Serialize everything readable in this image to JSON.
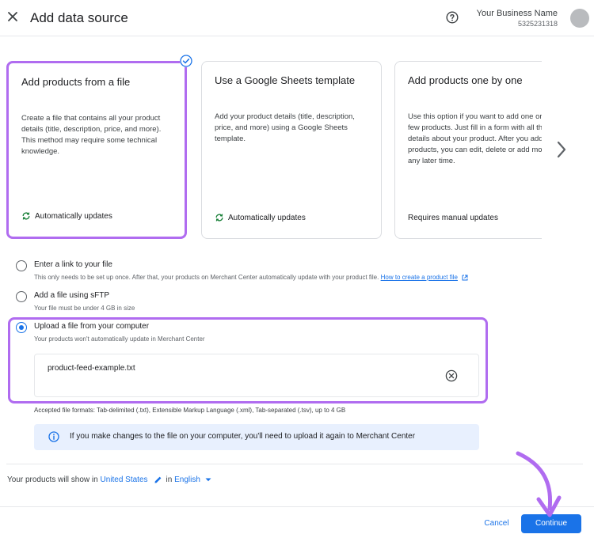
{
  "header": {
    "title": "Add data source",
    "business_name": "Your Business Name",
    "business_id": "5325231318"
  },
  "cards": [
    {
      "title": "Add products from a file",
      "description": "Create a file that contains all your product details (title, description, price, and more). This method may require some technical knowledge.",
      "footer": "Automatically updates",
      "footer_icon": "sync-icon",
      "selected": true
    },
    {
      "title": "Use a Google Sheets template",
      "description": "Add your product details (title, description, price, and more) using a Google Sheets template.",
      "footer": "Automatically updates",
      "footer_icon": "sync-icon",
      "selected": false
    },
    {
      "title": "Add products one by one",
      "description": "Use this option if you want to add one or just a few products. Just fill in a form with all the details about your product. After you add your products, you can edit, delete or add more at any later time.",
      "footer": "Requires manual updates",
      "selected": false
    }
  ],
  "options": [
    {
      "label": "Enter a link to your file",
      "sub": "This only needs to be set up once. After that, your products on Merchant Center automatically update with your product file.",
      "link": "How to create a product file"
    },
    {
      "label": "Add a file using sFTP",
      "sub": "Your file must be under 4 GB in size"
    },
    {
      "label": "Upload a file from your computer",
      "sub": "Your products won't automatically update in Merchant Center",
      "selected": true
    }
  ],
  "upload": {
    "file_name": "product-feed-example.txt",
    "formats": "Accepted file formats: Tab-delimited (.txt), Extensible Markup Language (.xml), Tab-separated (.tsv), up to 4 GB"
  },
  "info_banner": {
    "text": "If you make changes to the file on your computer, you'll need to upload it again to Merchant Center"
  },
  "country": {
    "prefix": "Your products will show in",
    "country": "United States",
    "in": "in",
    "language": "English"
  },
  "footer": {
    "cancel": "Cancel",
    "continue": "Continue"
  },
  "colors": {
    "accent": "#1a73e8",
    "highlight": "#b06cf0",
    "success": "#188038",
    "info_bg": "#e8f0fe"
  }
}
